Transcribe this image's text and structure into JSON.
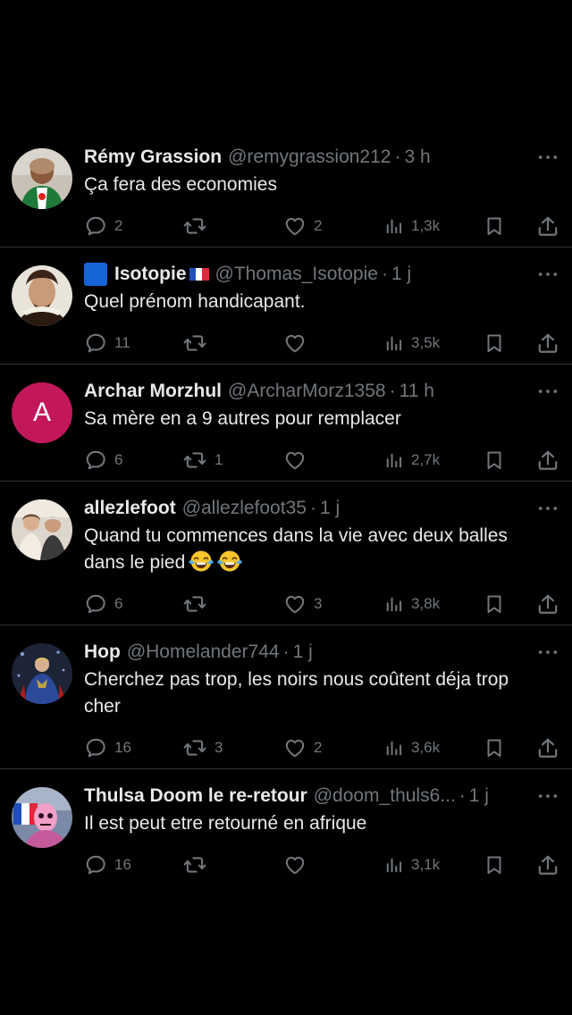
{
  "replies": [
    {
      "name": "Rémy Grassion",
      "handle": "@remygrassion212",
      "sep": "·",
      "time": "3 h",
      "text": "Ça fera des economies",
      "replies": "2",
      "retweets": "",
      "likes": "2",
      "views": "1,3k"
    },
    {
      "name": "Isotopie",
      "handle": "@Thomas_Isotopie",
      "sep": "·",
      "time": "1 j",
      "text": "Quel prénom handicapant.",
      "replies": "11",
      "retweets": "",
      "likes": "",
      "views": "3,5k"
    },
    {
      "name": "Archar Morzhul",
      "handle": "@ArcharMorz1358",
      "sep": "·",
      "time": "11 h",
      "avatar_letter": "A",
      "avatar_color": "#c2185b",
      "text": "Sa mère en a 9 autres pour remplacer",
      "replies": "6",
      "retweets": "1",
      "likes": "",
      "views": "2,7k"
    },
    {
      "name": "allezlefoot",
      "handle": "@allezlefoot35",
      "sep": "·",
      "time": "1 j",
      "text": "Quand tu commences dans la vie avec deux balles dans le pied",
      "emojis": [
        "face-with-tears-of-joy",
        "face-with-tears-of-joy"
      ],
      "replies": "6",
      "retweets": "",
      "likes": "3",
      "views": "3,8k"
    },
    {
      "name": "Hop",
      "handle": "@Homelander744",
      "sep": "·",
      "time": "1 j",
      "text": "Cherchez pas trop, les noirs nous coûtent déja trop cher",
      "replies": "16",
      "retweets": "3",
      "likes": "2",
      "views": "3,6k"
    },
    {
      "name": "Thulsa Doom le re-retour",
      "handle": "@doom_thuls6...",
      "sep": "·",
      "time": "1 j",
      "text": "Il est peut etre retourné en afrique",
      "replies": "16",
      "retweets": "",
      "likes": "",
      "views": "3,1k"
    }
  ],
  "colors": {
    "background": "#000000",
    "text_primary": "#e7e9ea",
    "text_secondary": "#71767b",
    "divider": "#2f3336",
    "blue_square_badge": "#1565d8"
  },
  "icons": {
    "reply": "reply-icon",
    "retweet": "retweet-icon",
    "like": "heart-icon",
    "views": "views-icon",
    "bookmark": "bookmark-icon",
    "share": "share-icon",
    "more": "more-icon"
  }
}
